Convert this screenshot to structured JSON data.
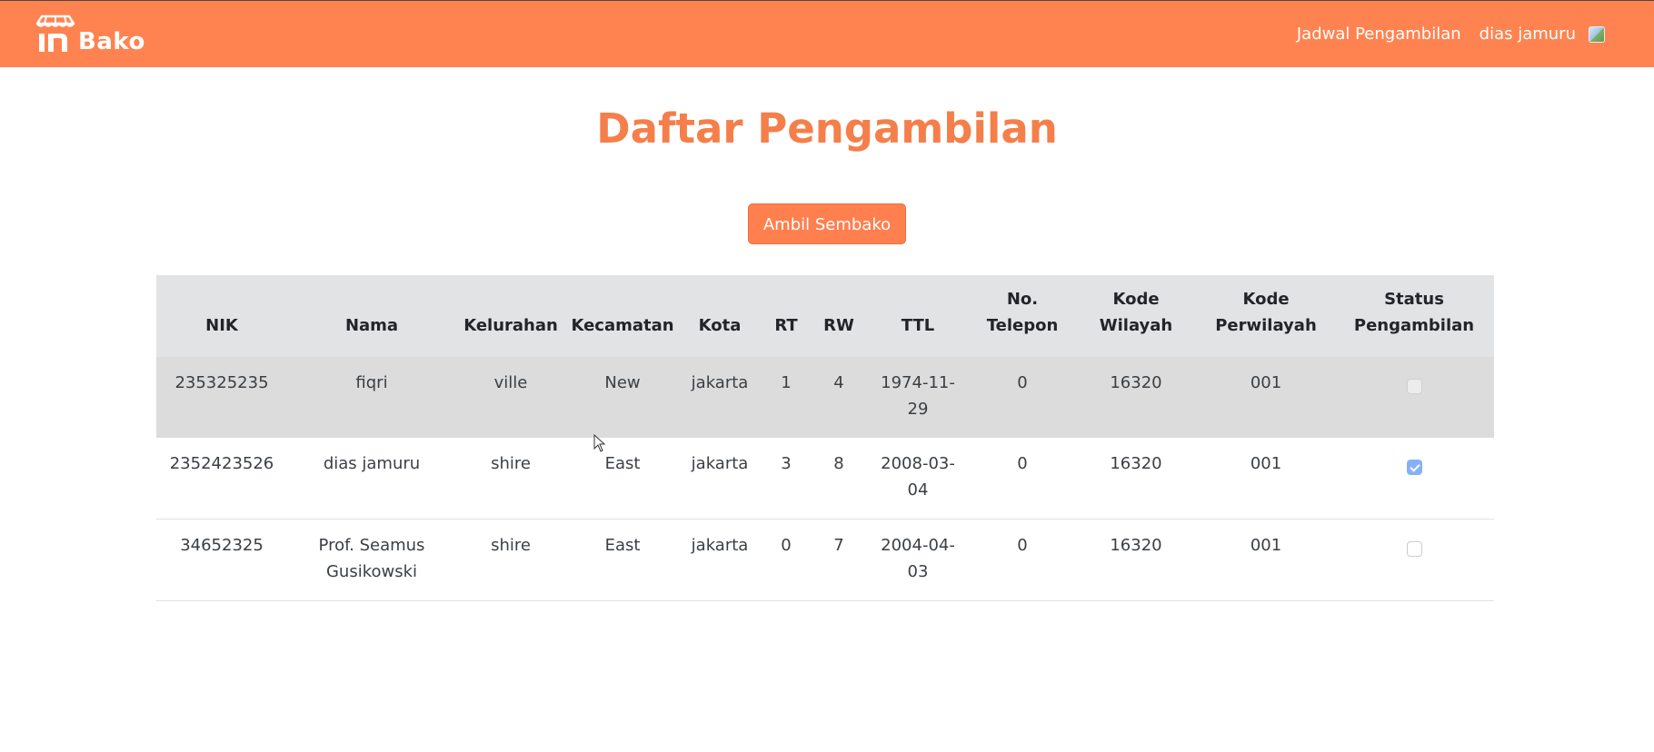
{
  "navbar": {
    "brand_text": "Bako",
    "links": [
      "Jadwal Pengambilan",
      "dias jamuru"
    ],
    "color": "#ff8350"
  },
  "page": {
    "title": "Daftar Pengambilan",
    "ambil_button": "Ambil Sembako",
    "accent_color": "#f57f4a"
  },
  "table": {
    "headers": [
      "NIK",
      "Nama",
      "Kelurahan",
      "Kecamatan",
      "Kota",
      "RT",
      "RW",
      "TTL",
      "No. Telepon",
      "Kode Wilayah",
      "Kode Perwilayah",
      "Status Pengambilan"
    ],
    "rows": [
      {
        "nik": "235325235",
        "nama": "fiqri",
        "kelurahan": "ville",
        "kecamatan": "New",
        "kota": "jakarta",
        "rt": "1",
        "rw": "4",
        "ttl": "1974-11-29",
        "telepon": "0",
        "kode_wilayah": "16320",
        "kode_perwilayah": "001",
        "status_checked": false
      },
      {
        "nik": "2352423526",
        "nama": "dias jamuru",
        "kelurahan": "shire",
        "kecamatan": "East",
        "kota": "jakarta",
        "rt": "3",
        "rw": "8",
        "ttl": "2008-03-04",
        "telepon": "0",
        "kode_wilayah": "16320",
        "kode_perwilayah": "001",
        "status_checked": true
      },
      {
        "nik": "34652325",
        "nama": "Prof. Seamus Gusikowski",
        "kelurahan": "shire",
        "kecamatan": "East",
        "kota": "jakarta",
        "rt": "0",
        "rw": "7",
        "ttl": "2004-04-03",
        "telepon": "0",
        "kode_wilayah": "16320",
        "kode_perwilayah": "001",
        "status_checked": false
      }
    ]
  }
}
